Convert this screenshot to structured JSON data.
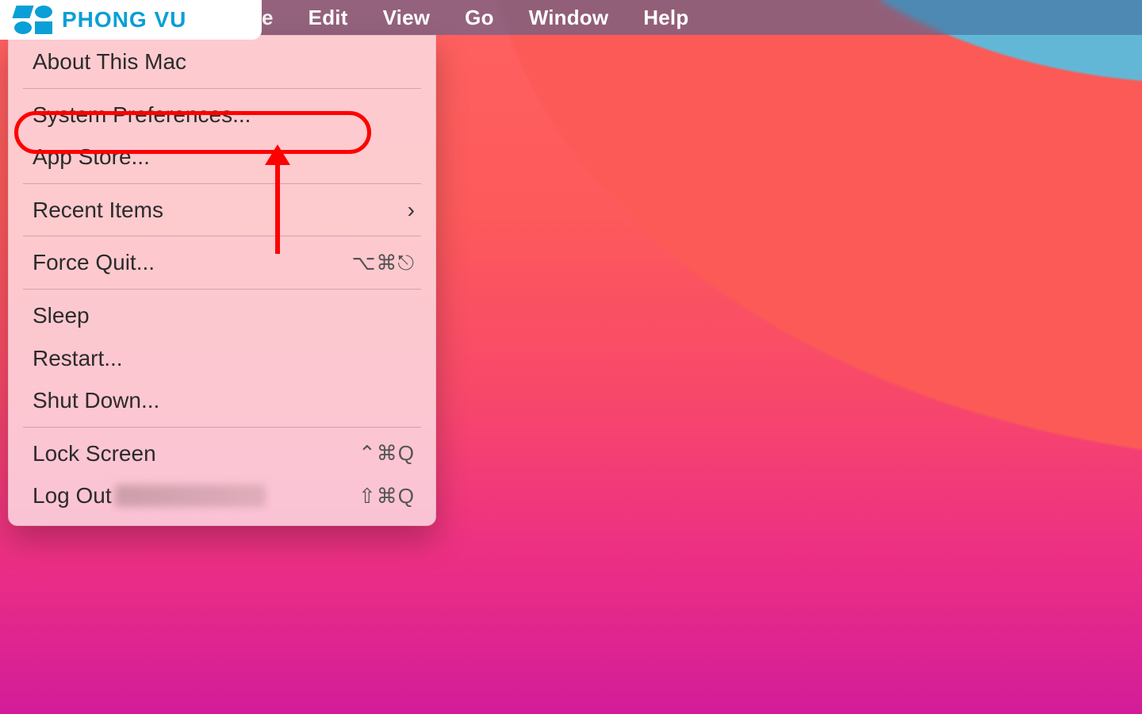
{
  "logo": {
    "text": "PHONG VU"
  },
  "menubar": {
    "partial_item": "e",
    "items": [
      "Edit",
      "View",
      "Go",
      "Window",
      "Help"
    ]
  },
  "apple_menu": {
    "about": "About This Mac",
    "system_preferences": "System Preferences...",
    "app_store": "App Store...",
    "recent_items": "Recent Items",
    "recent_items_arrow": "›",
    "force_quit": "Force Quit...",
    "force_quit_sc": "⌥⌘⎋",
    "sleep": "Sleep",
    "restart": "Restart...",
    "shut_down": "Shut Down...",
    "lock_screen": "Lock Screen",
    "lock_screen_sc": "⌃⌘Q",
    "log_out": "Log Out",
    "log_out_sc": "⇧⌘Q"
  },
  "annotation": {
    "highlighted_item": "System Preferences...",
    "arrow_points_to": "System Preferences..."
  }
}
